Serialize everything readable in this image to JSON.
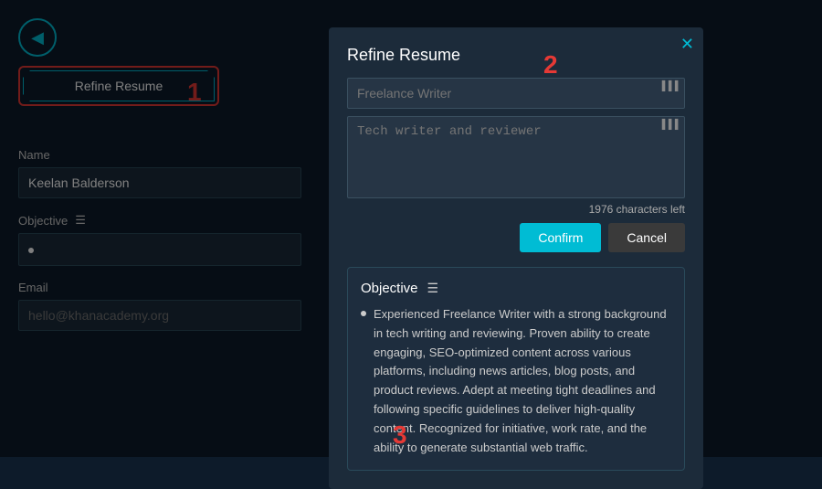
{
  "left_panel": {
    "back_icon": "◀",
    "refine_button_label": "Refine Resume",
    "num1": "1",
    "name_label": "Name",
    "name_value": "Keelan Balderson",
    "objective_label": "Objective",
    "email_label": "Email",
    "email_placeholder": "hello@khanacademy.org"
  },
  "modal": {
    "close_icon": "✕",
    "title": "Refine Resume",
    "num2": "2",
    "input_placeholder": "Freelance Writer",
    "textarea_placeholder": "Tech writer and reviewer",
    "chars_left": "1976 characters left",
    "confirm_label": "Confirm",
    "cancel_label": "Cancel",
    "objective_title": "Objective",
    "objective_text": "Experienced Freelance Writer with a strong background in tech writing and reviewing. Proven ability to create engaging, SEO-optimized content across various platforms, including news articles, blog posts, and product reviews. Adept at meeting tight deadlines and following specific guidelines to deliver high-quality content. Recognized for initiative, work rate, and the ability to generate substantial web traffic."
  },
  "num3": "3"
}
